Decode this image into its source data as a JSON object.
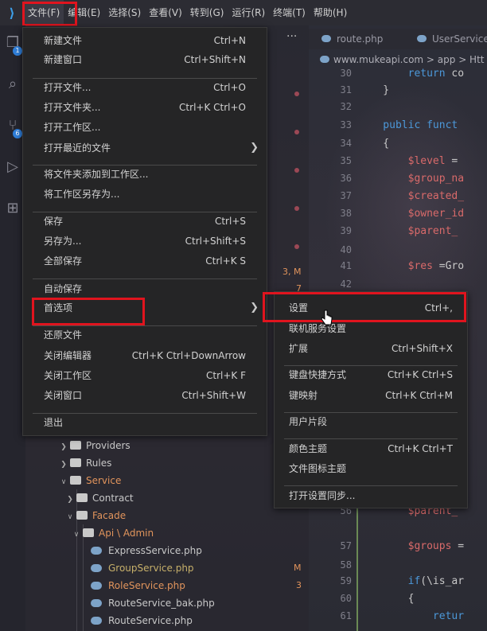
{
  "menubar": {
    "items": [
      "文件(F)",
      "编辑(E)",
      "选择(S)",
      "查看(V)",
      "转到(G)",
      "运行(R)",
      "终端(T)",
      "帮助(H)"
    ]
  },
  "activity": {
    "explorer_badge": "1",
    "scm_badge": "6"
  },
  "editor": {
    "tabs": [
      "route.php",
      "UserService"
    ],
    "breadcrumb": "www.mukeapi.com > app > Htt",
    "lines": [
      {
        "n": "30",
        "parts": [
          [
            "kw",
            "        return "
          ],
          [
            "pn",
            "co"
          ]
        ]
      },
      {
        "n": "31",
        "parts": [
          [
            "pn",
            "    }"
          ]
        ]
      },
      {
        "n": "32",
        "parts": [
          [
            "pn",
            ""
          ]
        ]
      },
      {
        "n": "33",
        "parts": [
          [
            "kw",
            "    public "
          ],
          [
            "kw",
            "funct"
          ]
        ]
      },
      {
        "n": "34",
        "parts": [
          [
            "pn",
            "    {"
          ]
        ]
      },
      {
        "n": "35",
        "parts": [
          [
            "vr",
            "        $level "
          ],
          [
            "pn",
            "="
          ]
        ]
      },
      {
        "n": "36",
        "parts": [
          [
            "vr",
            "        $group_na"
          ]
        ]
      },
      {
        "n": "37",
        "parts": [
          [
            "vr",
            "        $created_"
          ]
        ]
      },
      {
        "n": "38",
        "parts": [
          [
            "vr",
            "        $owner_id"
          ]
        ]
      },
      {
        "n": "39",
        "parts": [
          [
            "vr",
            "        $parent_"
          ]
        ]
      },
      {
        "n": "40",
        "parts": [
          [
            "pn",
            ""
          ]
        ]
      },
      {
        "n": "41",
        "parts": [
          [
            "vr",
            "        $res "
          ],
          [
            "pn",
            "=Gro"
          ]
        ]
      },
      {
        "n": "42",
        "parts": [
          [
            "pn",
            ""
          ]
        ]
      },
      {
        "n": "56",
        "parts": [
          [
            "vr",
            "        $parent_"
          ]
        ]
      },
      {
        "n": "57",
        "parts": [
          [
            "vr",
            "        $groups "
          ],
          [
            "pn",
            "="
          ]
        ]
      },
      {
        "n": "58",
        "parts": [
          [
            "pn",
            ""
          ]
        ]
      },
      {
        "n": "59",
        "parts": [
          [
            "kw",
            "        if"
          ],
          [
            "pn",
            "(\\is_ar"
          ]
        ]
      },
      {
        "n": "60",
        "parts": [
          [
            "pn",
            "        {"
          ]
        ]
      },
      {
        "n": "61",
        "parts": [
          [
            "kw",
            "            retur"
          ]
        ]
      }
    ]
  },
  "gutter": {
    "mark_3m": "3, M",
    "mark_7": "7"
  },
  "explorer": {
    "rows": [
      {
        "label": "Providers",
        "type": "folder",
        "open": false
      },
      {
        "label": "Rules",
        "type": "folder",
        "open": false
      },
      {
        "label": "Service",
        "type": "folder",
        "open": true,
        "color": "orange"
      },
      {
        "label": "Contract",
        "type": "folder",
        "open": false
      },
      {
        "label": "Facade",
        "type": "folder",
        "open": true,
        "color": "orange"
      },
      {
        "label": "Api \\ Admin",
        "type": "folder",
        "open": true,
        "color": "orange"
      },
      {
        "label": "ExpressService.php",
        "type": "php"
      },
      {
        "label": "GroupService.php",
        "type": "php",
        "badge": "M",
        "color": "modified"
      },
      {
        "label": "RoleService.php",
        "type": "php",
        "badge": "3",
        "color": "orange"
      },
      {
        "label": "RouteService_bak.php",
        "type": "php"
      },
      {
        "label": "RouteService.php",
        "type": "php"
      }
    ]
  },
  "file_menu": {
    "items": [
      {
        "label": "新建文件",
        "kbd": "Ctrl+N"
      },
      {
        "label": "新建窗口",
        "kbd": "Ctrl+Shift+N"
      },
      {
        "sep": true
      },
      {
        "label": "打开文件...",
        "kbd": "Ctrl+O"
      },
      {
        "label": "打开文件夹...",
        "kbd": "Ctrl+K Ctrl+O"
      },
      {
        "label": "打开工作区...",
        "kbd": ""
      },
      {
        "label": "打开最近的文件",
        "kbd": "",
        "submenu": true
      },
      {
        "sep": true
      },
      {
        "label": "将文件夹添加到工作区...",
        "kbd": ""
      },
      {
        "label": "将工作区另存为...",
        "kbd": ""
      },
      {
        "sep": true
      },
      {
        "label": "保存",
        "kbd": "Ctrl+S"
      },
      {
        "label": "另存为...",
        "kbd": "Ctrl+Shift+S"
      },
      {
        "label": "全部保存",
        "kbd": "Ctrl+K S"
      },
      {
        "sep": true
      },
      {
        "label": "自动保存",
        "kbd": ""
      },
      {
        "label": "首选项",
        "kbd": "",
        "submenu": true
      },
      {
        "sep": true
      },
      {
        "label": "还原文件",
        "kbd": ""
      },
      {
        "label": "关闭编辑器",
        "kbd": "Ctrl+K Ctrl+DownArrow"
      },
      {
        "label": "关闭工作区",
        "kbd": "Ctrl+K F"
      },
      {
        "label": "关闭窗口",
        "kbd": "Ctrl+Shift+W"
      },
      {
        "sep": true
      },
      {
        "label": "退出",
        "kbd": ""
      }
    ]
  },
  "prefs_menu": {
    "items": [
      {
        "label": "设置",
        "kbd": "Ctrl+,"
      },
      {
        "label": "联机服务设置",
        "kbd": ""
      },
      {
        "label": "扩展",
        "kbd": "Ctrl+Shift+X"
      },
      {
        "sep": true
      },
      {
        "label": "键盘快捷方式",
        "kbd": "Ctrl+K Ctrl+S"
      },
      {
        "label": "键映射",
        "kbd": "Ctrl+K Ctrl+M"
      },
      {
        "sep": true
      },
      {
        "label": "用户片段",
        "kbd": ""
      },
      {
        "sep": true
      },
      {
        "label": "颜色主题",
        "kbd": "Ctrl+K Ctrl+T"
      },
      {
        "label": "文件图标主题",
        "kbd": ""
      },
      {
        "sep": true
      },
      {
        "label": "打开设置同步...",
        "kbd": ""
      }
    ]
  },
  "colors": {
    "highlight_box": "#e0141e",
    "accent_blue": "#2f7ed8"
  }
}
